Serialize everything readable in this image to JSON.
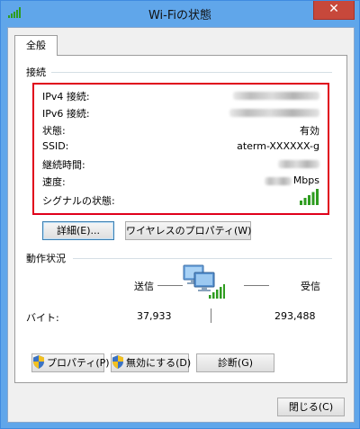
{
  "window": {
    "title": "Wi-Fiの状態",
    "close_glyph": "✕"
  },
  "tabs": [
    {
      "label": "全般"
    }
  ],
  "connection": {
    "group_label": "接続",
    "rows": [
      {
        "label": "IPv4 接続:"
      },
      {
        "label": "IPv6 接続:"
      },
      {
        "label": "状態:",
        "value": "有効"
      },
      {
        "label": "SSID:",
        "value": "aterm-XXXXXX-g"
      },
      {
        "label": "継続時間:"
      },
      {
        "label": "速度:",
        "unit": "Mbps"
      },
      {
        "label": "シグナルの状態:"
      }
    ],
    "signal_bars": 5,
    "highlight_color": "#e0001b"
  },
  "buttons": {
    "details": "詳細(E)...",
    "wireless_properties": "ワイヤレスのプロパティ(W)"
  },
  "activity": {
    "group_label": "動作状況",
    "sent_label": "送信",
    "received_label": "受信",
    "bytes_label": "バイト:",
    "bytes_sent": "37,933",
    "bytes_received": "293,488"
  },
  "bottom_buttons": {
    "properties": "プロパティ(P)",
    "disable": "無効にする(D)",
    "diagnose": "診断(G)"
  },
  "close_button": "閉じる(C)",
  "colors": {
    "titlebar": "#60a6ea",
    "close": "#c7483b",
    "signal": "#2e9c1f"
  }
}
